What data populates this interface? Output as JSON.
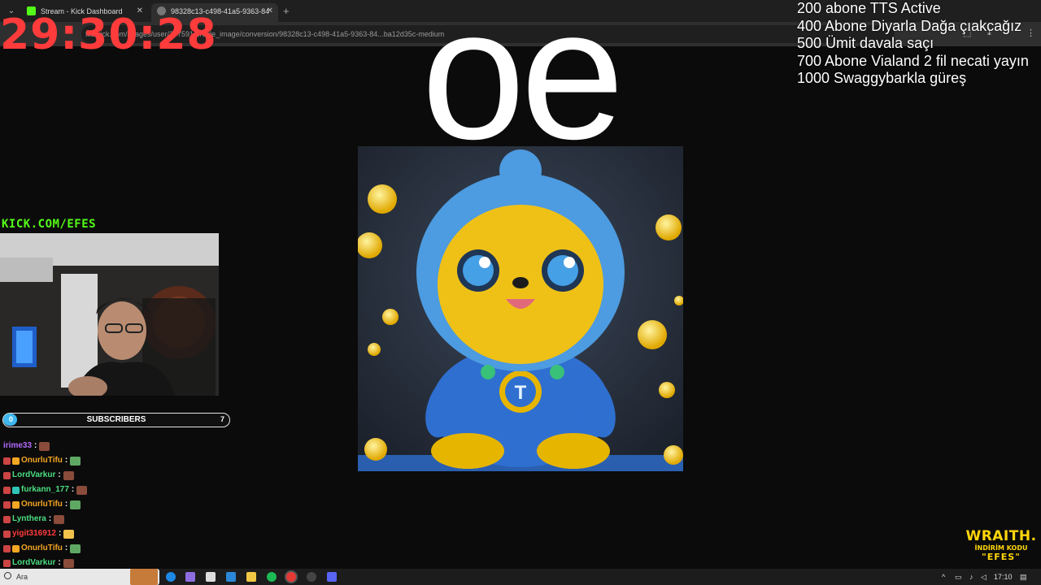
{
  "browser": {
    "tabs": [
      {
        "title": "Stream - Kick Dashboard"
      },
      {
        "title": "98328c13-c498-41a5-9363-84"
      }
    ],
    "address": "file:kick.com/images/user/207591/profile_image/conversion/98328c13-c498-41a5-9363-84...ba12d35c-medium"
  },
  "overlay": {
    "timer": "29:30:28",
    "big_text": "oe",
    "goals": [
      "200 abone TTS Active",
      "400 Abone Diyarla Dağa çıakcağız",
      "500 Ümit davala saçı",
      "700 Abone Vialand 2 fil necati yayın",
      "1000 Swaggybarkla güreş"
    ],
    "kick_url": "KICK.COM/EFES",
    "subscribers": {
      "label": "SUBSCRIBERS",
      "current": "0",
      "goal": "7",
      "progress": 0.06
    },
    "brand": {
      "title": "WRAITH.",
      "subtitle": "İNDİRİM KODU",
      "code": "\"EFES\""
    }
  },
  "chat": [
    {
      "user": "irime33",
      "color": "#b36bff",
      "badges": []
    },
    {
      "user": "OnurluTifu",
      "color": "#f5a623",
      "badges": [
        "#c44",
        "#f5a623"
      ]
    },
    {
      "user": "LordVarkur",
      "color": "#4ade80",
      "badges": [
        "#c44"
      ]
    },
    {
      "user": "furkann_177",
      "color": "#4ade80",
      "badges": [
        "#c44",
        "#2ec4b6"
      ]
    },
    {
      "user": "OnurluTifu",
      "color": "#f5a623",
      "badges": [
        "#c44",
        "#f5a623"
      ]
    },
    {
      "user": "Lynthera",
      "color": "#4ade80",
      "badges": [
        "#c44"
      ]
    },
    {
      "user": "yigit316912",
      "color": "#ff3b3b",
      "badges": [
        "#c44"
      ]
    },
    {
      "user": "OnurluTifu",
      "color": "#f5a623",
      "badges": [
        "#c44",
        "#f5a623"
      ]
    },
    {
      "user": "LordVarkur",
      "color": "#4ade80",
      "badges": [
        "#c44"
      ]
    }
  ],
  "taskbar": {
    "search_text": "Ara",
    "clock": "17:10"
  }
}
